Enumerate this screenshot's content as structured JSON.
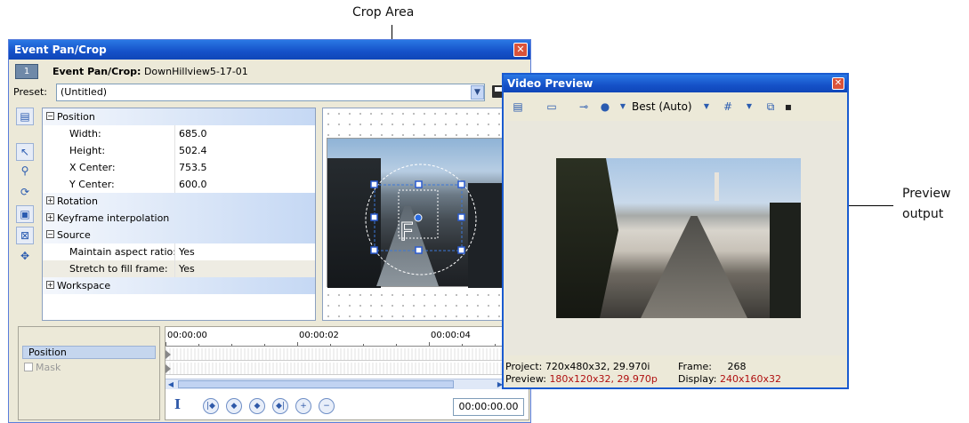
{
  "callouts": {
    "crop_area": "Crop Area",
    "preview_output_line1": "Preview",
    "preview_output_line2": "output"
  },
  "pancrop": {
    "title": "Event Pan/Crop",
    "event_number": "1",
    "event_label": "Event Pan/Crop:",
    "event_name": "DownHillview5-17-01",
    "preset_label": "Preset:",
    "preset_value": "(Untitled)",
    "properties": [
      {
        "type": "group",
        "expanded": true,
        "label": "Position"
      },
      {
        "type": "prop",
        "name": "Width:",
        "value": "685.0"
      },
      {
        "type": "prop",
        "name": "Height:",
        "value": "502.4"
      },
      {
        "type": "prop",
        "name": "X Center:",
        "value": "753.5"
      },
      {
        "type": "prop",
        "name": "Y Center:",
        "value": "600.0"
      },
      {
        "type": "group",
        "expanded": false,
        "label": "Rotation"
      },
      {
        "type": "group",
        "expanded": false,
        "label": "Keyframe interpolation"
      },
      {
        "type": "group",
        "expanded": true,
        "label": "Source"
      },
      {
        "type": "prop",
        "name": "Maintain aspect ratio:",
        "value": "Yes"
      },
      {
        "type": "prop",
        "name": "Stretch to fill frame:",
        "value": "Yes"
      },
      {
        "type": "group",
        "expanded": false,
        "label": "Workspace"
      }
    ],
    "timeline": {
      "track_position": "Position",
      "track_mask": "Mask",
      "times": [
        "00:00:00",
        "00:00:02",
        "00:00:04"
      ],
      "timecode": "00:00:00.00"
    }
  },
  "preview": {
    "title": "Video Preview",
    "quality": "Best (Auto)",
    "project_label": "Project:",
    "project_value": "720x480x32, 29.970i",
    "frame_label": "Frame:",
    "frame_value": "268",
    "preview_label": "Preview:",
    "preview_value": "180x120x32, 29.970p",
    "display_label": "Display:",
    "display_value": "240x160x32"
  }
}
